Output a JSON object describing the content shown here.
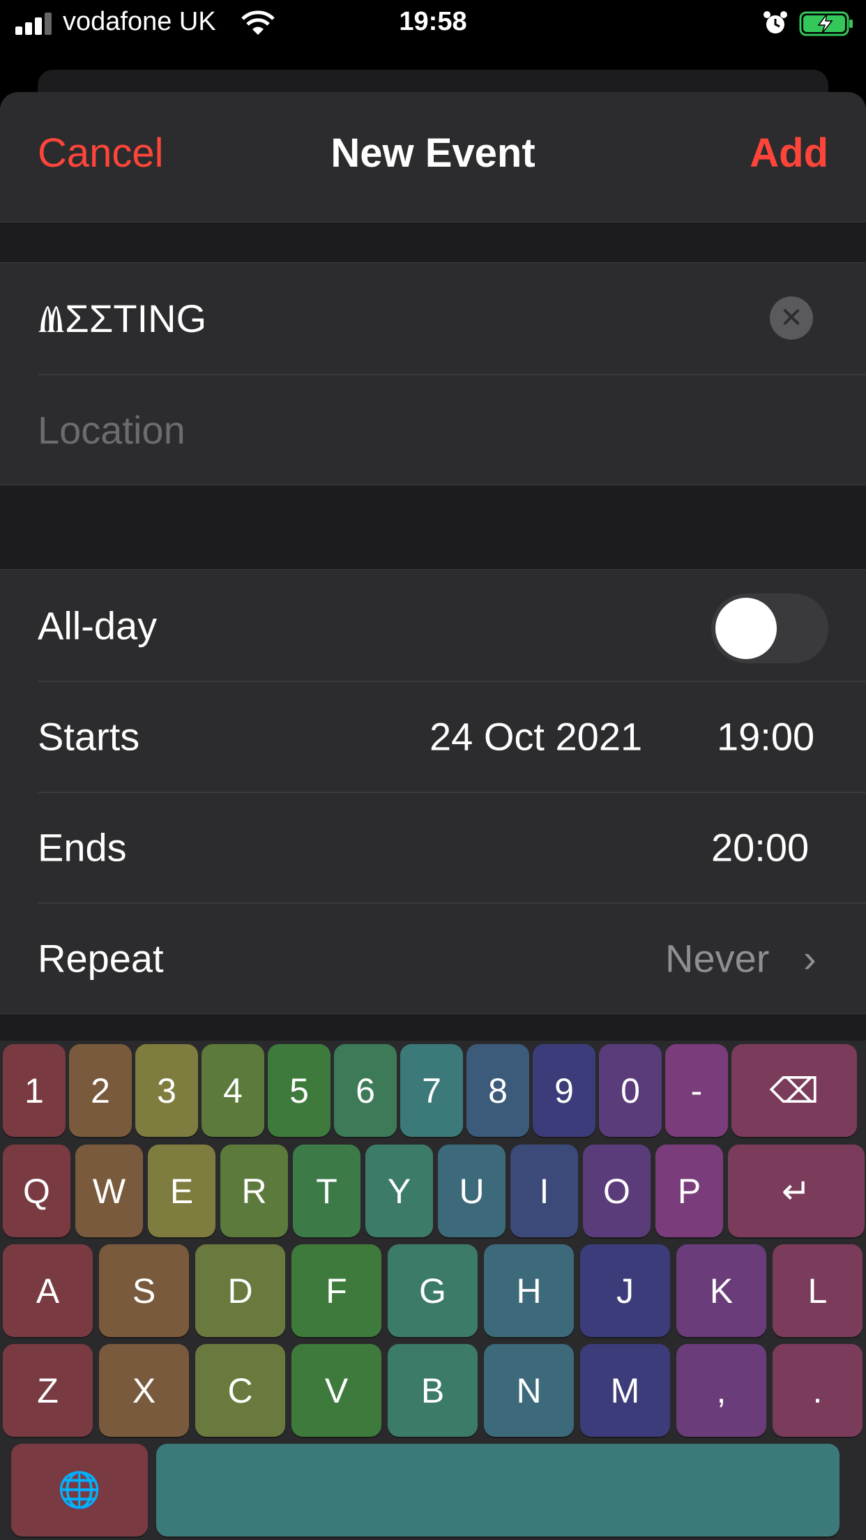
{
  "status_bar": {
    "carrier": "vodafone UK",
    "time": "19:58",
    "icons": [
      "signal-icon",
      "wifi-icon",
      "alarm-icon",
      "battery-charging-icon"
    ]
  },
  "nav": {
    "cancel_label": "Cancel",
    "title": "New Event",
    "add_label": "Add",
    "accent_color": "#ff453a"
  },
  "title_field": {
    "value": "ⰮƩƩTING",
    "clear_icon": "✕"
  },
  "location_field": {
    "placeholder": "Location",
    "value": ""
  },
  "allday": {
    "label": "All-day",
    "on": false
  },
  "starts": {
    "label": "Starts",
    "date": "24 Oct 2021",
    "time": "19:00"
  },
  "ends": {
    "label": "Ends",
    "time": "20:00"
  },
  "repeat": {
    "label": "Repeat",
    "value": "Never",
    "chevron": "›"
  },
  "keyboard": {
    "rows": [
      [
        "1",
        "2",
        "3",
        "4",
        "5",
        "6",
        "7",
        "8",
        "9",
        "0",
        "-",
        "⌫"
      ],
      [
        "Q",
        "W",
        "E",
        "R",
        "T",
        "Y",
        "U",
        "I",
        "O",
        "P",
        "↵"
      ],
      [
        "A",
        "S",
        "D",
        "F",
        "G",
        "H",
        "J",
        "K",
        "L"
      ],
      [
        "Z",
        "X",
        "C",
        "V",
        "B",
        "N",
        "M",
        ",",
        "."
      ],
      [
        "🌐",
        ""
      ]
    ],
    "colors": [
      [
        "#7a3a42",
        "#7a5a3c",
        "#7e7c3e",
        "#5c7a3c",
        "#3e7a3c",
        "#3c7a58",
        "#3c7a7a",
        "#3c5a7a",
        "#3c3c7a",
        "#5a3c7a",
        "#7a3c7a",
        "#7a3c5a"
      ],
      [
        "#7a3a42",
        "#7a5a3c",
        "#7e7c3e",
        "#5c7a3c",
        "#3c7a48",
        "#3c7a6a",
        "#3c6a7a",
        "#3c4a7a",
        "#5a3c7a",
        "#7a3c7a",
        "#7a3c5a"
      ],
      [
        "#7a3a42",
        "#7a5a3c",
        "#6a7a3e",
        "#3e7a3c",
        "#3c7a6a",
        "#3c6a7a",
        "#3c3c7a",
        "#6a3c7a",
        "#7a3c5a"
      ],
      [
        "#7a3a42",
        "#7a5a3c",
        "#6a7a3e",
        "#3e7a3c",
        "#3c7a6a",
        "#3c6a7a",
        "#3c3c7a",
        "#6a3c7a",
        "#7a3c5a"
      ],
      [
        "#7a3a42",
        "#3c7a7a"
      ]
    ]
  }
}
